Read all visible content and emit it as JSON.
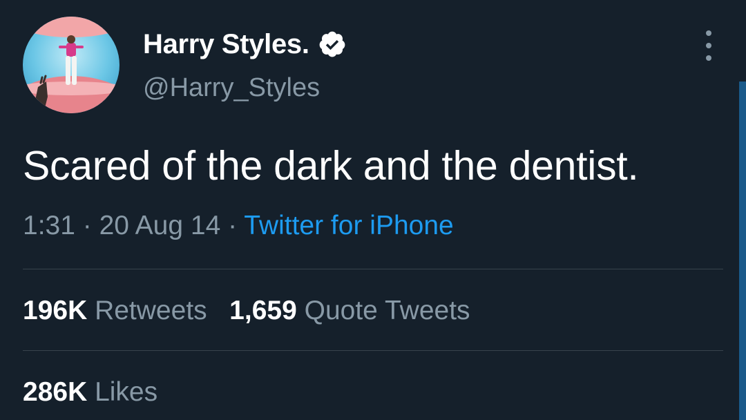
{
  "author": {
    "display_name": "Harry Styles.",
    "handle": "@Harry_Styles",
    "verified": true,
    "avatar_icon": "profile-photo"
  },
  "tweet": {
    "text": "Scared of the dark and the dentist.",
    "time": "1:31",
    "separator": "·",
    "date": "20 Aug 14",
    "source": "Twitter for iPhone"
  },
  "stats": {
    "retweets_count": "196K",
    "retweets_label": "Retweets",
    "quotes_count": "1,659",
    "quotes_label": "Quote Tweets",
    "likes_count": "286K",
    "likes_label": "Likes"
  },
  "colors": {
    "background": "#15202b",
    "secondary_text": "#8899a6",
    "link": "#1d9bf0",
    "divider": "#38444d"
  }
}
